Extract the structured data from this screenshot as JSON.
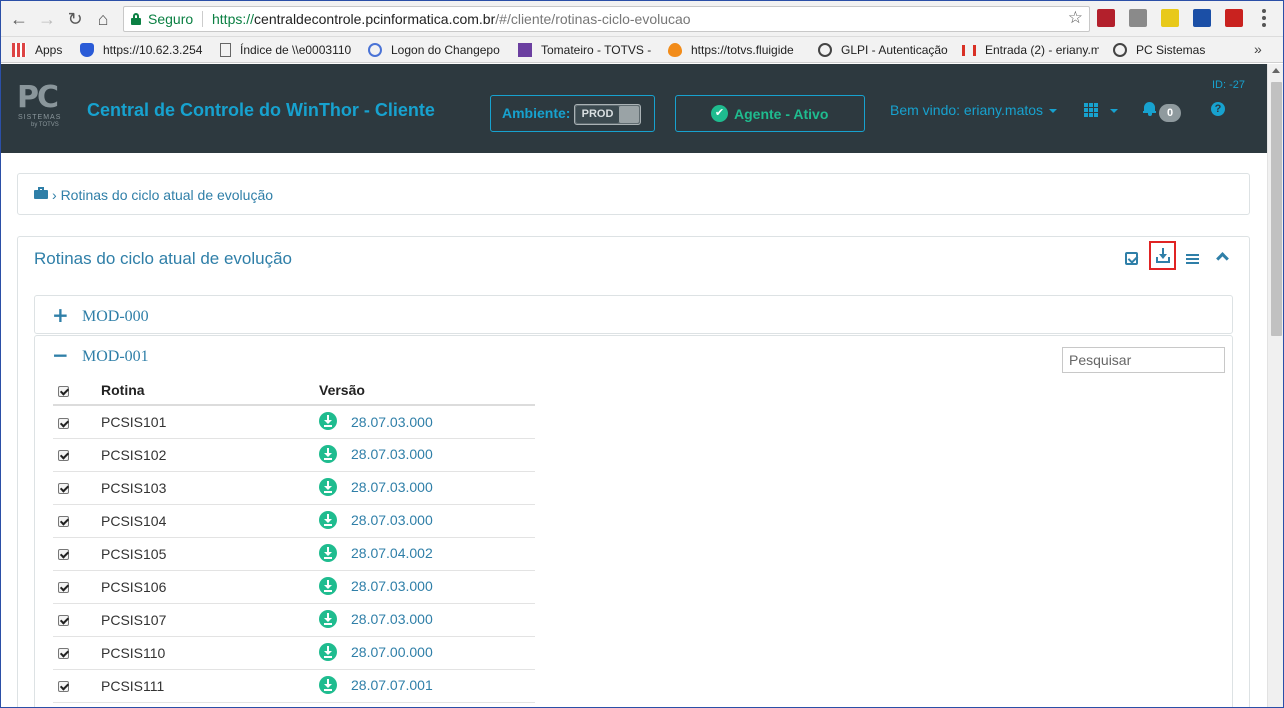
{
  "browser": {
    "secure_label": "Seguro",
    "url_scheme": "https://",
    "url_host": "centraldecontrole.pcinformatica.com.br",
    "url_path": "/#/cliente/rotinas-ciclo-evolucao",
    "bookmarks": [
      {
        "label": "Apps",
        "icon": "apps-grid-icon"
      },
      {
        "label": "https://10.62.3.254",
        "icon": "shield-icon"
      },
      {
        "label": "Índice de \\\\e0003110",
        "icon": "page-icon"
      },
      {
        "label": "Logon do Changepo",
        "icon": "g-logo-icon"
      },
      {
        "label": "Tomateiro - TOTVS -",
        "icon": "list-icon"
      },
      {
        "label": "https://totvs.fluigide",
        "icon": "flame-icon"
      },
      {
        "label": "GLPI - Autenticação",
        "icon": "g-logo-icon"
      },
      {
        "label": "Entrada (2) - eriany.m",
        "icon": "gmail-icon"
      },
      {
        "label": "PC Sistemas",
        "icon": "g-logo-icon"
      }
    ],
    "bookmarks_more": "»"
  },
  "header": {
    "logo_text": "PC",
    "logo_sub": "SISTEMAS",
    "logo_sub2": "by TOTVS",
    "title": "Central de Controle do WinThor - Cliente",
    "env_label": "Ambiente:",
    "env_value": "PROD",
    "agent_label": "Agente - Ativo",
    "welcome": "Bem vindo: eriany.matos",
    "notification_count": "0",
    "help": "?",
    "id_label": "ID: -27",
    "colors": {
      "bg": "#2d393f",
      "accent": "#17a2cf",
      "success": "#1fbc8f"
    }
  },
  "breadcrumb": {
    "separator": "›",
    "current": "Rotinas do ciclo atual de evolução"
  },
  "panel": {
    "title": "Rotinas do ciclo atual de evolução",
    "modules": [
      {
        "name": "MOD-000",
        "expanded": false,
        "sign": "+"
      },
      {
        "name": "MOD-001",
        "expanded": true,
        "sign": "−"
      }
    ],
    "search_placeholder": "Pesquisar",
    "columns": {
      "rotina": "Rotina",
      "versao": "Versão"
    },
    "rows": [
      {
        "rotina": "PCSIS101",
        "versao": "28.07.03.000"
      },
      {
        "rotina": "PCSIS102",
        "versao": "28.07.03.000"
      },
      {
        "rotina": "PCSIS103",
        "versao": "28.07.03.000"
      },
      {
        "rotina": "PCSIS104",
        "versao": "28.07.03.000"
      },
      {
        "rotina": "PCSIS105",
        "versao": "28.07.04.002"
      },
      {
        "rotina": "PCSIS106",
        "versao": "28.07.03.000"
      },
      {
        "rotina": "PCSIS107",
        "versao": "28.07.03.000"
      },
      {
        "rotina": "PCSIS110",
        "versao": "28.07.00.000"
      },
      {
        "rotina": "PCSIS111",
        "versao": "28.07.07.001"
      }
    ]
  }
}
